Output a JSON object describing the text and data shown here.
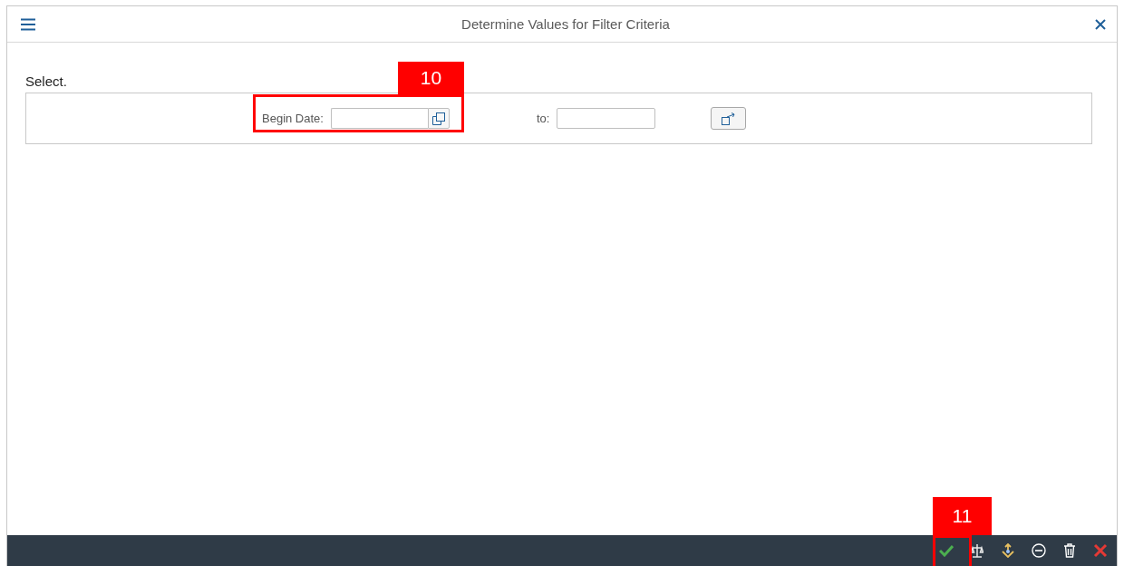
{
  "window": {
    "title": "Determine Values for Filter Criteria"
  },
  "section_label": "Select.",
  "filter": {
    "begin_label": "Begin Date:",
    "to_label": "to:"
  },
  "callouts": [
    {
      "number": "10"
    },
    {
      "number": "11"
    }
  ]
}
